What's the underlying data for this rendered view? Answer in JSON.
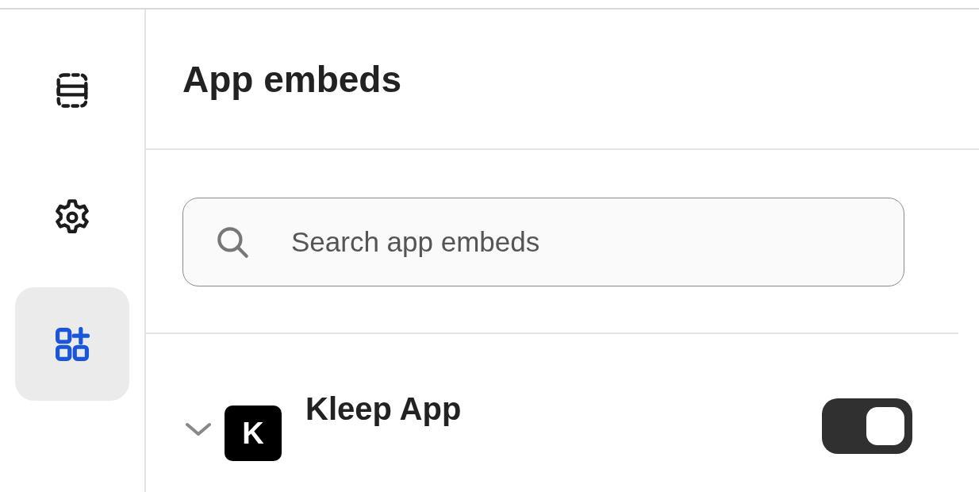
{
  "sidebar": {
    "items": [
      {
        "kind": "sections",
        "selected": false
      },
      {
        "kind": "settings",
        "selected": false
      },
      {
        "kind": "apps",
        "selected": true
      }
    ]
  },
  "panel": {
    "title": "App embeds",
    "search": {
      "placeholder": "Search app embeds"
    },
    "embeds": [
      {
        "name": "Kleep App",
        "logo_letter": "K",
        "expanded": false,
        "on": true
      }
    ]
  }
}
